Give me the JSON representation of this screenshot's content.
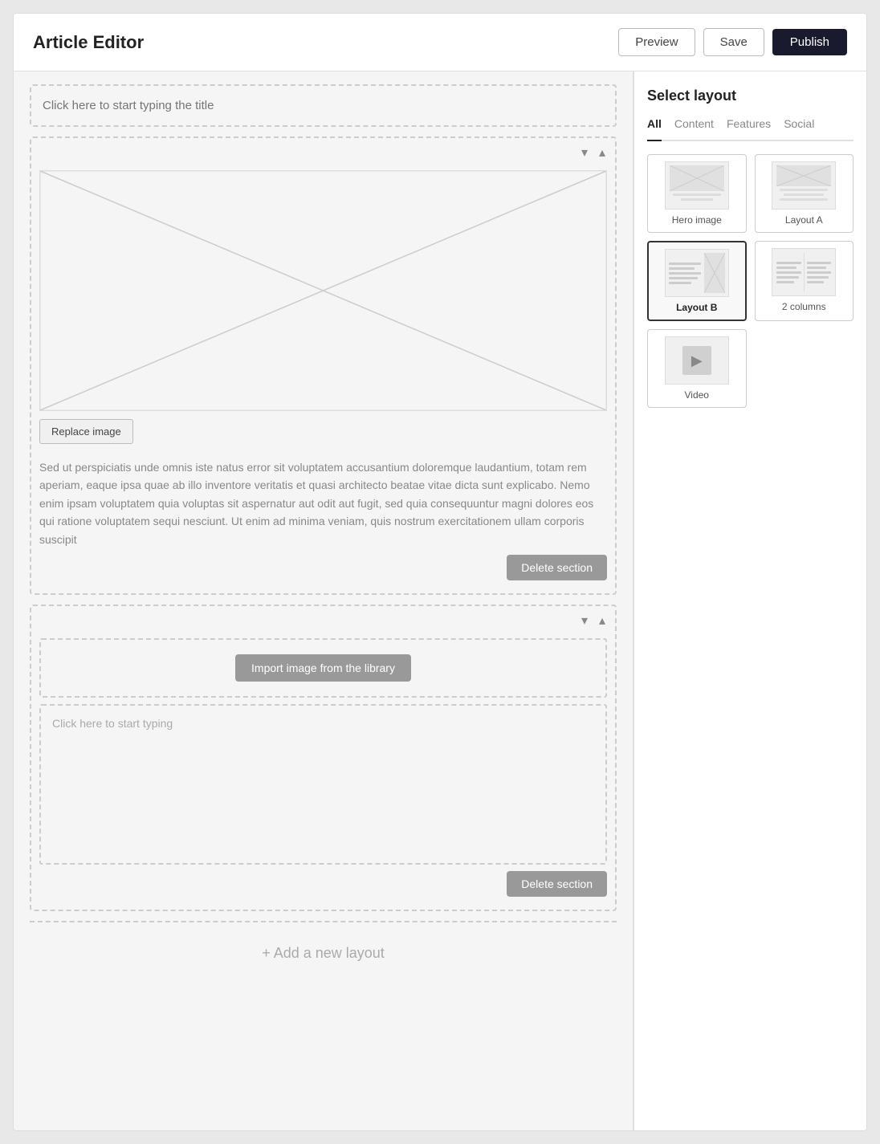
{
  "header": {
    "title": "Article Editor",
    "preview_label": "Preview",
    "save_label": "Save",
    "publish_label": "Publish"
  },
  "title_section": {
    "placeholder": "Click here to start typing the title"
  },
  "section1": {
    "replace_image_label": "Replace image",
    "body_text": "Sed ut perspiciatis unde omnis iste natus error sit voluptatem accusantium doloremque laudantium, totam rem aperiam, eaque ipsa quae ab illo inventore veritatis et quasi architecto beatae vitae dicta sunt explicabo. Nemo enim ipsam voluptatem quia voluptas sit aspernatur aut odit aut fugit, sed quia consequuntur magni dolores eos qui ratione voluptatem sequi nesciunt.  Ut enim ad minima veniam, quis nostrum exercitationem ullam corporis suscipit",
    "delete_label": "Delete section"
  },
  "section2": {
    "import_image_label": "Import image from the library",
    "text_placeholder": "Click here to start typing",
    "delete_label": "Delete section"
  },
  "add_layout": {
    "label": "+ Add a new layout"
  },
  "sidebar": {
    "title": "Select layout",
    "tabs": [
      {
        "id": "all",
        "label": "All",
        "active": true
      },
      {
        "id": "content",
        "label": "Content",
        "active": false
      },
      {
        "id": "features",
        "label": "Features",
        "active": false
      },
      {
        "id": "social",
        "label": "Social",
        "active": false
      }
    ],
    "layouts": [
      {
        "id": "hero-image",
        "label": "Hero image",
        "selected": false
      },
      {
        "id": "layout-a",
        "label": "Layout A",
        "selected": false
      },
      {
        "id": "layout-b",
        "label": "Layout B",
        "selected": true
      },
      {
        "id": "2-columns",
        "label": "2 columns",
        "selected": false
      },
      {
        "id": "video",
        "label": "Video",
        "selected": false
      }
    ]
  },
  "icons": {
    "chevron_down": "▾",
    "chevron_up": "▴",
    "camera": "📷"
  }
}
